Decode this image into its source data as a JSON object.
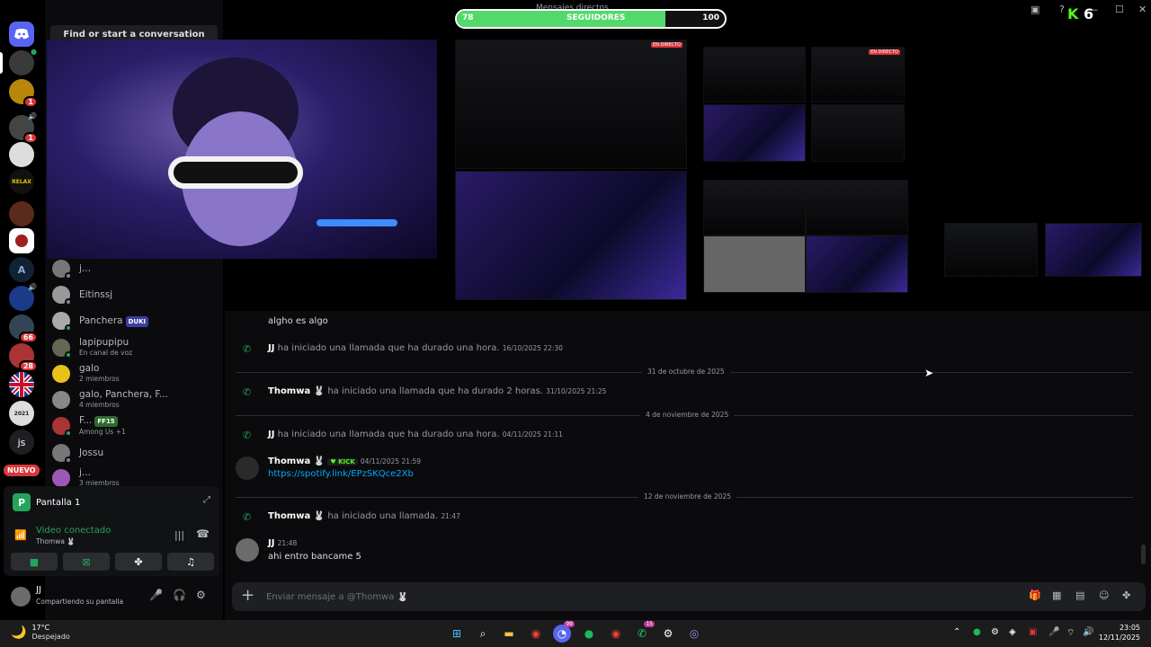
{
  "window": {
    "title": "Mensajes directos"
  },
  "overlay": {
    "follow_current": "78",
    "follow_label": "SEGUIDORES",
    "follow_goal": "100",
    "follow_fraction": 0.78,
    "kick_count": "6"
  },
  "rail": {
    "servers": [
      {
        "name": "discord-home",
        "label": "",
        "badge": ""
      },
      {
        "name": "server-avatar-1",
        "label": "",
        "badge": ""
      },
      {
        "name": "server-avatar-2",
        "label": "",
        "badge": "1"
      },
      {
        "name": "server-avatar-3",
        "label": "",
        "badge": "1"
      },
      {
        "name": "server-avatar-4",
        "label": "",
        "badge": ""
      },
      {
        "name": "server-relax",
        "label": "RELAX",
        "badge": ""
      },
      {
        "name": "server-game",
        "label": "",
        "badge": ""
      },
      {
        "name": "server-avatar-5",
        "label": "",
        "badge": ""
      },
      {
        "name": "server-a",
        "label": "A",
        "badge": ""
      },
      {
        "name": "server-avatar-6",
        "label": "",
        "badge": ""
      },
      {
        "name": "server-avatar-7",
        "label": "",
        "badge": "66"
      },
      {
        "name": "server-avatar-8",
        "label": "",
        "badge": "28"
      },
      {
        "name": "server-uk-flag",
        "label": "",
        "badge": ""
      },
      {
        "name": "server-2021",
        "label": "2021",
        "badge": ""
      },
      {
        "name": "server-js",
        "label": "js",
        "badge": ""
      }
    ],
    "new_label": "NUEVO"
  },
  "dms": {
    "search_label": "Find or start a conversation",
    "items": [
      {
        "name": "j...",
        "sub": "",
        "tag": ""
      },
      {
        "name": "Eitinssj",
        "sub": "",
        "tag": ""
      },
      {
        "name": "Panchera",
        "sub": "",
        "tag": "DUKI"
      },
      {
        "name": "lapipupipu",
        "sub": "En canal de voz",
        "tag": ""
      },
      {
        "name": "galo",
        "sub": "2 miembros",
        "tag": ""
      },
      {
        "name": "galo, Panchera, F...",
        "sub": "4 miembros",
        "tag": ""
      },
      {
        "name": "F...",
        "sub": "Among Us +1",
        "tag": "FF15"
      },
      {
        "name": "Jossu",
        "sub": "",
        "tag": ""
      },
      {
        "name": "j...",
        "sub": "3 miembros",
        "tag": ""
      }
    ]
  },
  "voice": {
    "screen_label": "Pantalla 1",
    "connected_label": "Video conectado",
    "connected_user": "Thomwa 🐰"
  },
  "user": {
    "name": "JJ",
    "status": "Compartiendo su pantalla"
  },
  "chat": {
    "top_partial": "algho es algo",
    "messages": [
      {
        "kind": "call",
        "author": "JJ",
        "text": "ha iniciado una llamada que ha durado una hora.",
        "ts": "16/10/2025 22:30"
      },
      {
        "kind": "divider",
        "label": "31 de octubre de 2025"
      },
      {
        "kind": "call",
        "author": "Thomwa 🐰",
        "text": "ha iniciado una llamada que ha durado 2 horas.",
        "ts": "31/10/2025 21:25"
      },
      {
        "kind": "divider",
        "label": "4 de noviembre de 2025"
      },
      {
        "kind": "call",
        "author": "JJ",
        "text": "ha iniciado una llamada que ha durado una hora.",
        "ts": "04/11/2025 21:11"
      },
      {
        "kind": "msg",
        "author": "Thomwa 🐰",
        "tag": "KICK",
        "ts": "04/11/2025 21:59",
        "text": "https://spotify.link/EPzSKQce2Xb"
      },
      {
        "kind": "divider",
        "label": "12 de noviembre de 2025"
      },
      {
        "kind": "call",
        "author": "Thomwa 🐰",
        "text": "ha iniciado una llamada.",
        "ts": "21:47"
      },
      {
        "kind": "msg",
        "author": "JJ",
        "tag": "",
        "ts": "21:48",
        "text": "ahi entro bancame 5"
      }
    ],
    "composer_placeholder": "Enviar mensaje a @Thomwa 🐰"
  },
  "taskbar": {
    "temp": "17°C",
    "weather": "Despejado",
    "time": "23:05",
    "date": "12/11/2025",
    "badges": {
      "discord": "99",
      "whatsapp": "15"
    }
  },
  "colors": {
    "accent_green": "#23a55a",
    "link": "#00a8fc",
    "red": "#da373c",
    "kick_green": "#53fc18"
  }
}
